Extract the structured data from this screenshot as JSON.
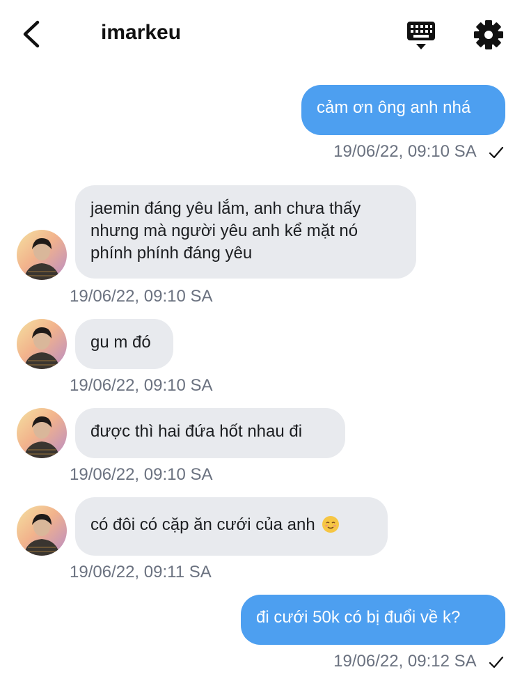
{
  "header": {
    "title": "imarkeu",
    "back_icon": "chevron-left-icon",
    "keyboard_icon": "keyboard-icon",
    "settings_icon": "gear-icon"
  },
  "colors": {
    "outgoing_bubble": "#4d9ff0",
    "incoming_bubble": "#e8eaee",
    "timestamp": "#6b7280"
  },
  "messages": [
    {
      "direction": "out",
      "text": "cảm ơn ông anh nhá",
      "time": "19/06/22, 09:10 SA",
      "status_icon": "check-icon"
    },
    {
      "direction": "in",
      "text": "jaemin đáng yêu lắm, anh chưa thấy\nnhưng mà người yêu anh kể mặt nó\nphính phính đáng yêu",
      "time": "19/06/22, 09:10 SA"
    },
    {
      "direction": "in",
      "text": "gu m đó",
      "time": "19/06/22, 09:10 SA"
    },
    {
      "direction": "in",
      "text": "được thì hai đứa hốt nhau đi",
      "time": "19/06/22, 09:10 SA"
    },
    {
      "direction": "in",
      "text": "có đôi có cặp ăn cưới của anh",
      "emoji": "relieved-face-emoji",
      "time": "19/06/22, 09:11 SA"
    },
    {
      "direction": "out",
      "text": "đi cưới 50k có bị đuổi về k?",
      "time": "19/06/22, 09:12 SA",
      "status_icon": "check-icon"
    }
  ]
}
